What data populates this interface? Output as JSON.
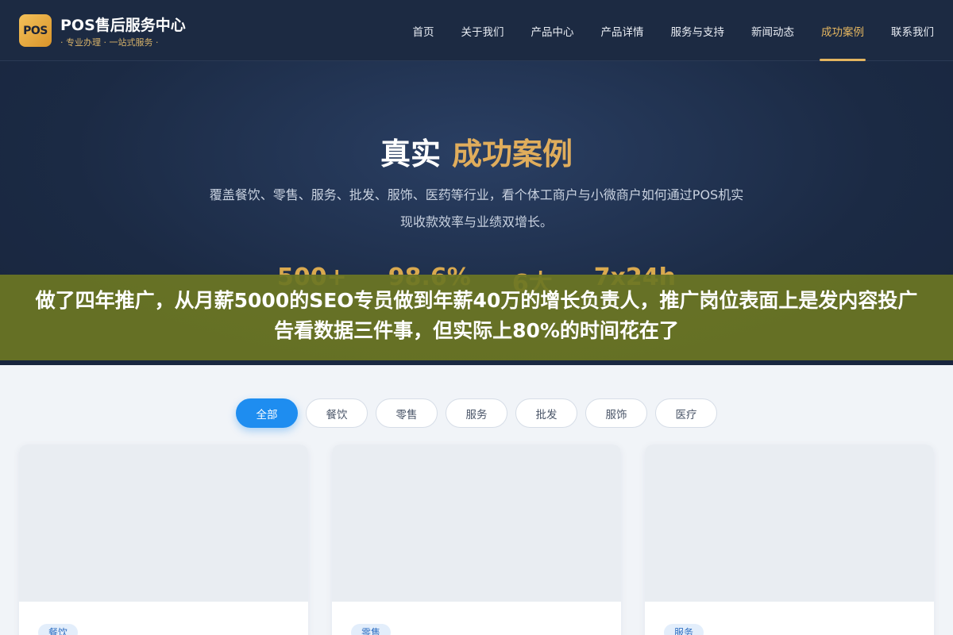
{
  "header": {
    "logo_text": "POS",
    "brand_title": "POS售后服务中心",
    "brand_subtitle": "· 专业办理 · 一站式服务 ·",
    "nav": [
      "首页",
      "关于我们",
      "产品中心",
      "产品详情",
      "服务与支持",
      "新闻动态",
      "成功案例",
      "联系我们"
    ],
    "active_nav": "成功案例"
  },
  "hero": {
    "title_white": "真实",
    "title_gold": "成功案例",
    "description": "覆盖餐饮、零售、服务、批发、服饰、医药等行业，看个体工商户与小微商户如何通过POS机实现收款效率与业绩双增长。",
    "stats": [
      "500+",
      "98.6%",
      "6大",
      "7x24h"
    ]
  },
  "overlay_text": "做了四年推广，从月薪5000的SEO专员做到年薪40万的增长负责人，推广岗位表面上是发内容投广告看数据三件事，但实际上80%的时间花在了",
  "filters": [
    "全部",
    "餐饮",
    "零售",
    "服务",
    "批发",
    "服饰",
    "医疗"
  ],
  "active_filter": "全部",
  "cards": [
    {
      "tag": "餐饮"
    },
    {
      "tag": "零售"
    },
    {
      "tag": "服务"
    }
  ],
  "colors": {
    "header_bg": "#1c2a42",
    "accent_gold": "#e0ad5c",
    "filter_active": "#1e8df0",
    "overlay": "#6c7624"
  }
}
